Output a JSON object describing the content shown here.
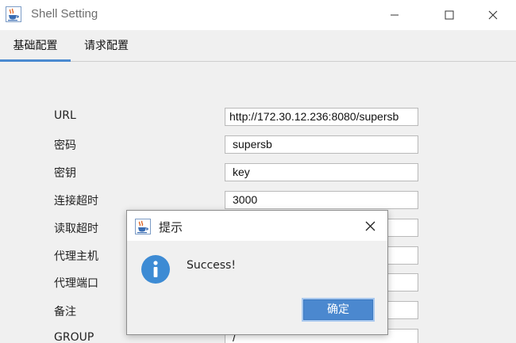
{
  "window": {
    "title": "Shell Setting",
    "icon": "java-cup-icon",
    "controls": [
      "minimize-icon",
      "maximize-icon",
      "close-icon"
    ]
  },
  "tabs": [
    {
      "label": "基础配置",
      "active": true
    },
    {
      "label": "请求配置",
      "active": false
    }
  ],
  "form": {
    "fields": [
      {
        "label": "URL",
        "value": "http://172.30.12.236:8080/supersb"
      },
      {
        "label": "密码",
        "value": "supersb"
      },
      {
        "label": "密钥",
        "value": "key"
      },
      {
        "label": "连接超时",
        "value": "3000"
      },
      {
        "label": "读取超时",
        "value": ""
      },
      {
        "label": "代理主机",
        "value": ""
      },
      {
        "label": "代理端口",
        "value": ""
      },
      {
        "label": "备注",
        "value": ""
      },
      {
        "label": "GROUP",
        "value": "/"
      }
    ]
  },
  "dialog": {
    "title": "提示",
    "message": "Success!",
    "ok_label": "确定",
    "icon": "info-icon"
  },
  "colors": {
    "accent": "#4a8ad0",
    "button": "#4b88cf",
    "info_icon": "#3d8bd4"
  }
}
